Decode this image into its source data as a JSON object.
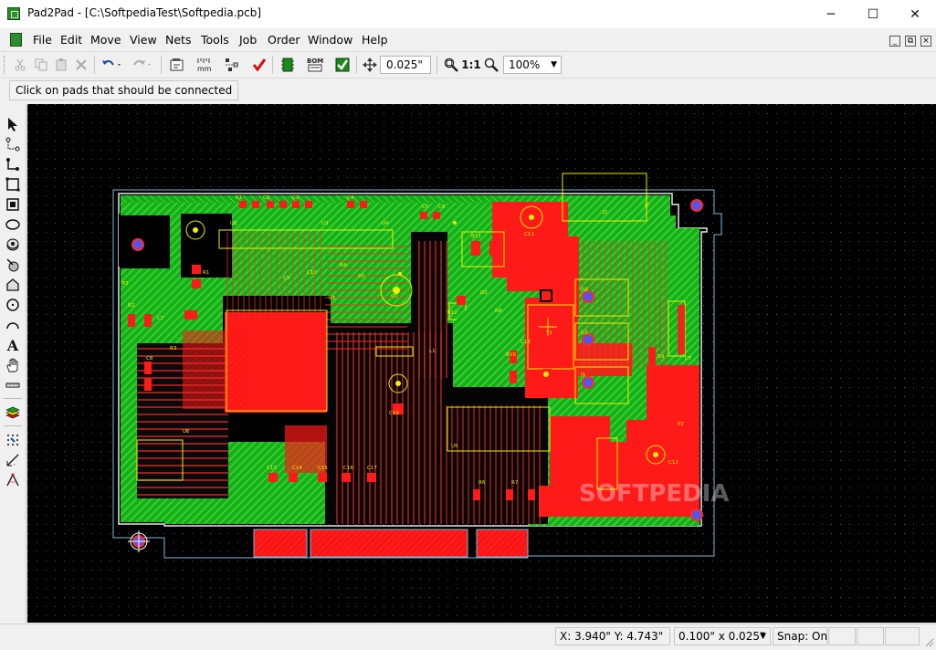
{
  "window": {
    "title": "Pad2Pad - [C:\\SoftpediaTest\\Softpedia.pcb]",
    "minimize_glyph": "─",
    "maximize_glyph": "☐",
    "close_glyph": "✕"
  },
  "menu": {
    "items": [
      "File",
      "Edit",
      "Move",
      "View",
      "Nets",
      "Tools",
      "Job",
      "Order",
      "Window",
      "Help"
    ],
    "mdi_buttons": [
      "_",
      "⧉",
      "×"
    ]
  },
  "toolbar": {
    "icons": [
      "scissors-icon",
      "copy-icon",
      "paste-icon",
      "delete-icon",
      "undo-icon",
      "redo-icon",
      "properties-icon",
      "units-icon",
      "align-icon",
      "check-icon",
      "component-icon",
      "bom-icon",
      "drc-icon",
      "move-icon"
    ],
    "units_label": "mm",
    "bom_label": "BOM",
    "grid_step": "0.025\"",
    "zoom_one_label": "1:1",
    "zoom_value": "100%"
  },
  "hint": {
    "text": "Click on pads that should be connected"
  },
  "left_tools": [
    "select-arrow-icon",
    "connect-pads-icon",
    "trace-icon",
    "rectangle-icon",
    "rectangle-fill-icon",
    "ellipse-icon",
    "via-icon",
    "pad-icon",
    "polygon-icon",
    "circle-icon",
    "arc-icon",
    "text-icon",
    "hand-pan-icon",
    "ruler-icon",
    "layers-icon",
    "snap-grid-icon",
    "dimension-icon",
    "measure-icon"
  ],
  "text_tool_glyph": "A",
  "canvas": {
    "watermark": "SOFTPEDIA",
    "labels": [
      "U1",
      "U2",
      "U3",
      "U4",
      "U5",
      "U6",
      "U7",
      "C1",
      "C2",
      "C3",
      "C4",
      "C5",
      "C6",
      "C7",
      "C8",
      "C9",
      "C10",
      "C11",
      "C12",
      "C13",
      "C14",
      "C15",
      "C16",
      "C17",
      "C18",
      "C19",
      "R1",
      "R2",
      "R3",
      "R4",
      "R5",
      "R6",
      "R7",
      "R8",
      "R9",
      "R10",
      "R11",
      "R12",
      "Q1",
      "Q2",
      "Q3",
      "D1",
      "D2",
      "J1",
      "J2",
      "L1",
      "Y1",
      "P1",
      "P2"
    ]
  },
  "status": {
    "coords": "X: 3.940\"  Y: 4.743\"",
    "grid": "0.100\" x 0.025\"",
    "snap": "Snap: On"
  },
  "colors": {
    "board_green": "#16b816",
    "copper_red": "#ff1a1a",
    "silkscreen_yellow": "#f0f000",
    "board_outline": "#e8e8e8",
    "pad_blue": "#5555ee",
    "canvas_bg": "#000000",
    "grid_dot": "#5a5a5a"
  }
}
